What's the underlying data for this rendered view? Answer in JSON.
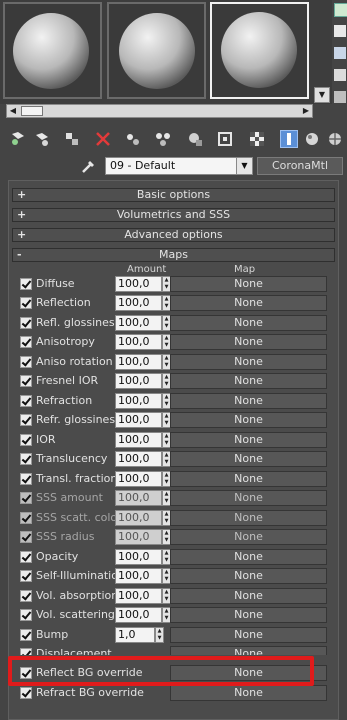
{
  "material": {
    "name": "09 - Default",
    "type": "CoronaMtl"
  },
  "rollouts": [
    {
      "sign": "+",
      "label": "Basic options"
    },
    {
      "sign": "+",
      "label": "Volumetrics and SSS"
    },
    {
      "sign": "+",
      "label": "Advanced options"
    },
    {
      "sign": "-",
      "label": "Maps"
    }
  ],
  "maps": {
    "col_amount": "Amount",
    "col_map": "Map",
    "rows": [
      {
        "label": "Diffuse",
        "amount": "100,0",
        "map": "None"
      },
      {
        "label": "Reflection",
        "amount": "100,0",
        "map": "None"
      },
      {
        "label": "Refl. glossiness",
        "amount": "100,0",
        "map": "None"
      },
      {
        "label": "Anisotropy",
        "amount": "100,0",
        "map": "None"
      },
      {
        "label": "Aniso rotation",
        "amount": "100,0",
        "map": "None"
      },
      {
        "label": "Fresnel IOR",
        "amount": "100,0",
        "map": "None"
      },
      {
        "label": "Refraction",
        "amount": "100,0",
        "map": "None"
      },
      {
        "label": "Refr. glossiness",
        "amount": "100,0",
        "map": "None"
      },
      {
        "label": "IOR",
        "amount": "100,0",
        "map": "None"
      },
      {
        "label": "Translucency",
        "amount": "100,0",
        "map": "None"
      },
      {
        "label": "Transl. fraction",
        "amount": "100,0",
        "map": "None"
      },
      {
        "label": "SSS amount",
        "amount": "100,0",
        "map": "None"
      },
      {
        "label": "SSS scatt. color",
        "amount": "100,0",
        "map": "None"
      },
      {
        "label": "SSS radius",
        "amount": "100,0",
        "map": "None"
      },
      {
        "label": "Opacity",
        "amount": "100,0",
        "map": "None"
      },
      {
        "label": "Self-Illumination",
        "amount": "100,0",
        "map": "None"
      },
      {
        "label": "Vol. absorption",
        "amount": "100,0",
        "map": "None"
      },
      {
        "label": "Vol. scattering",
        "amount": "100,0",
        "map": "None"
      },
      {
        "label": "Bump",
        "amount": "1,0",
        "map": "None"
      },
      {
        "label": "Displacement",
        "amount": "",
        "map": "None"
      },
      {
        "label": "Reflect BG override",
        "amount": "",
        "map": "None"
      },
      {
        "label": "Refract BG override",
        "amount": "",
        "map": "None"
      }
    ]
  },
  "colors": {
    "highlight": "#e01b1b",
    "active_tool": "#5b8fd6"
  }
}
